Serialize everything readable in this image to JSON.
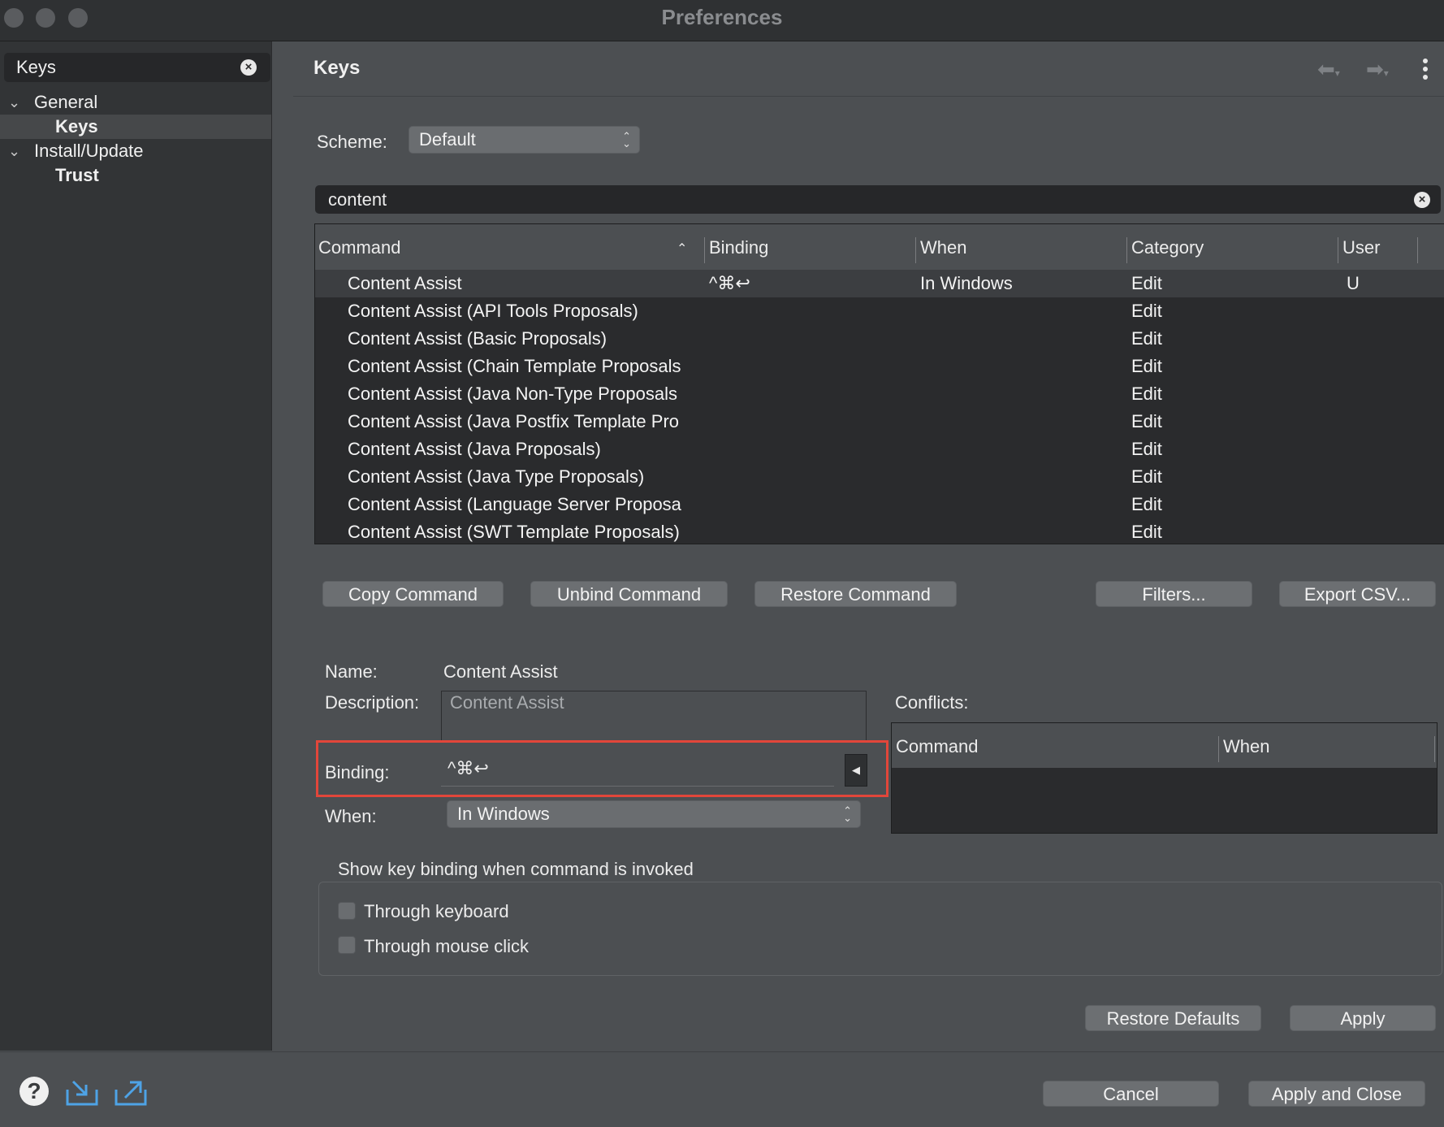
{
  "window": {
    "title": "Preferences"
  },
  "sidebar": {
    "filter_value": "Keys",
    "items": [
      {
        "label": "General",
        "expanded": true
      },
      {
        "label": "Keys",
        "selected": true
      },
      {
        "label": "Install/Update",
        "expanded": true
      },
      {
        "label": "Trust"
      }
    ]
  },
  "page": {
    "title": "Keys",
    "scheme_label": "Scheme:",
    "scheme_value": "Default",
    "search_value": "content"
  },
  "table": {
    "columns": [
      "Command",
      "Binding",
      "When",
      "Category",
      "User"
    ],
    "rows": [
      {
        "command": "Content Assist",
        "binding": "^⌘↩",
        "when": "In Windows",
        "category": "Edit",
        "user": "U"
      },
      {
        "command": "Content Assist (API Tools Proposals)",
        "binding": "",
        "when": "",
        "category": "Edit",
        "user": ""
      },
      {
        "command": "Content Assist (Basic Proposals)",
        "binding": "",
        "when": "",
        "category": "Edit",
        "user": ""
      },
      {
        "command": "Content Assist (Chain Template Proposals",
        "binding": "",
        "when": "",
        "category": "Edit",
        "user": ""
      },
      {
        "command": "Content Assist (Java Non-Type Proposals",
        "binding": "",
        "when": "",
        "category": "Edit",
        "user": ""
      },
      {
        "command": "Content Assist (Java Postfix Template Pro",
        "binding": "",
        "when": "",
        "category": "Edit",
        "user": ""
      },
      {
        "command": "Content Assist (Java Proposals)",
        "binding": "",
        "when": "",
        "category": "Edit",
        "user": ""
      },
      {
        "command": "Content Assist (Java Type Proposals)",
        "binding": "",
        "when": "",
        "category": "Edit",
        "user": ""
      },
      {
        "command": "Content Assist (Language Server Proposa",
        "binding": "",
        "when": "",
        "category": "Edit",
        "user": ""
      },
      {
        "command": "Content Assist (SWT Template Proposals)",
        "binding": "",
        "when": "",
        "category": "Edit",
        "user": ""
      }
    ]
  },
  "actions": {
    "copy": "Copy Command",
    "unbind": "Unbind Command",
    "restore": "Restore Command",
    "filters": "Filters...",
    "export": "Export CSV..."
  },
  "details": {
    "name_label": "Name:",
    "name_value": "Content Assist",
    "description_label": "Description:",
    "description_value": "Content Assist",
    "binding_label": "Binding:",
    "binding_value": "^⌘↩",
    "when_label": "When:",
    "when_value": "In Windows",
    "conflicts_label": "Conflicts:",
    "conflict_columns": [
      "Command",
      "When"
    ]
  },
  "show_binding": {
    "title": "Show key binding when command is invoked",
    "keyboard": {
      "label": "Through keyboard",
      "checked": false
    },
    "mouse": {
      "label": "Through mouse click",
      "checked": false
    }
  },
  "footer": {
    "restore_defaults": "Restore Defaults",
    "apply": "Apply",
    "cancel": "Cancel",
    "apply_close": "Apply and Close"
  },
  "colors": {
    "highlight_border": "#e2463a"
  }
}
